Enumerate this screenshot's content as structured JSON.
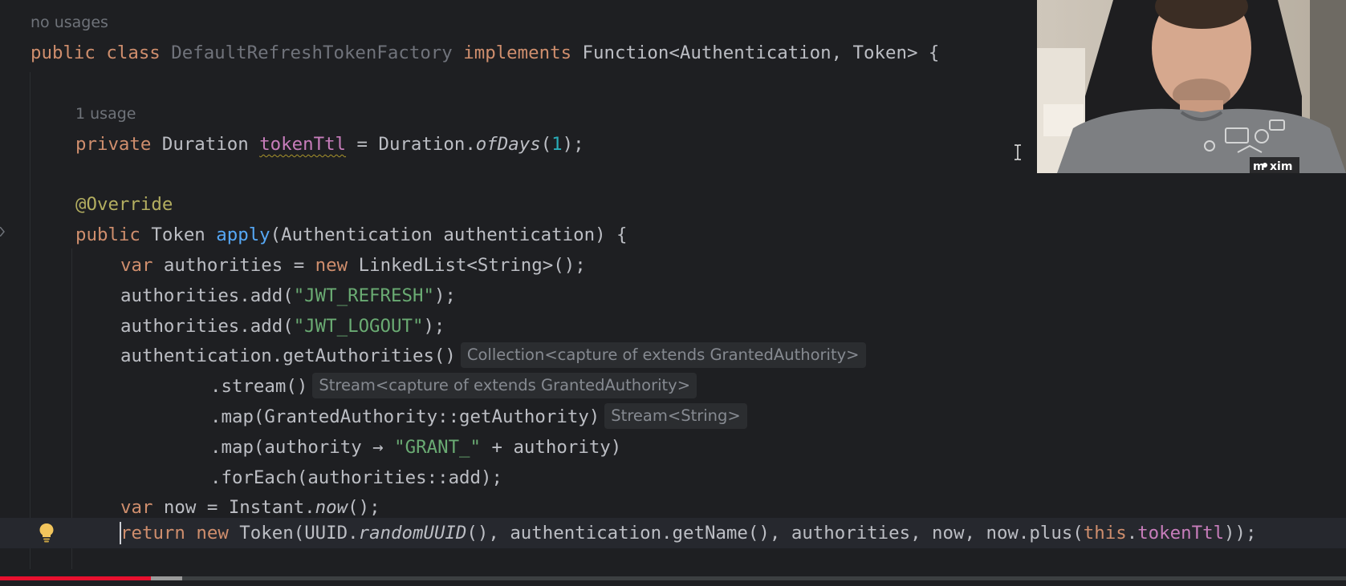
{
  "editor": {
    "hints": {
      "class_usages": "no usages",
      "field_usages": "1 usage"
    },
    "code": {
      "l1": {
        "kw_public": "public",
        "kw_class": "class",
        "class_name": "DefaultRefreshTokenFactory",
        "kw_implements": "implements",
        "rest": "Function<Authentication, Token> {"
      },
      "l2": {
        "kw_private": "private",
        "type": "Duration",
        "field": "tokenTtl",
        "eq": " = Duration.",
        "method": "ofDays",
        "open": "(",
        "num": "1",
        "close": ");"
      },
      "l3": {
        "annotation": "@Override"
      },
      "l4": {
        "kw_public": "public",
        "type": "Token",
        "method": "apply",
        "params": "(Authentication authentication) {"
      },
      "l5": {
        "kw_var": "var",
        "mid": " authorities = ",
        "kw_new": "new",
        "rest": " LinkedList<String>();"
      },
      "l6": {
        "pre": "authorities.add(",
        "str": "\"JWT_REFRESH\"",
        "post": ");"
      },
      "l7": {
        "pre": "authorities.add(",
        "str": "\"JWT_LOGOUT\"",
        "post": ");"
      },
      "l8": {
        "code": "authentication.getAuthorities()",
        "inlay": "Collection<capture of extends GrantedAuthority>"
      },
      "l9": {
        "code": ".stream()",
        "inlay": "Stream<capture of extends GrantedAuthority>"
      },
      "l10": {
        "code": ".map(GrantedAuthority::getAuthority)",
        "inlay": "Stream<String>"
      },
      "l11": {
        "pre": ".map(authority → ",
        "str": "\"GRANT_\"",
        "post": " + authority)"
      },
      "l12": {
        "code": ".forEach(authorities::add);"
      },
      "l13": {
        "kw_var": "var",
        "mid": " now = Instant.",
        "method": "now",
        "post": "();"
      },
      "l14": {
        "kw_return": "return",
        "kw_new": "new",
        "a": " Token(UUID.",
        "method": "randomUUID",
        "b": "(), authentication.getName(), authorities, now, now.plus(",
        "kw_this": "this",
        "dot": ".",
        "field": "tokenTtl",
        "end": "));"
      }
    }
  },
  "video": {
    "progress_fraction": 0.112,
    "buffered_fraction": 0.135
  },
  "icons": {
    "intention": "lightbulb-icon",
    "text_cursor": "text-cursor-icon",
    "webcam": "webcam-overlay"
  },
  "colors": {
    "background": "#1e1f22",
    "keyword": "#cf8e6d",
    "method": "#56a8f5",
    "field": "#c77dbb",
    "string": "#6aab73",
    "number": "#2aacb8",
    "annotation": "#b3ae60",
    "progress": "#e8102e"
  }
}
